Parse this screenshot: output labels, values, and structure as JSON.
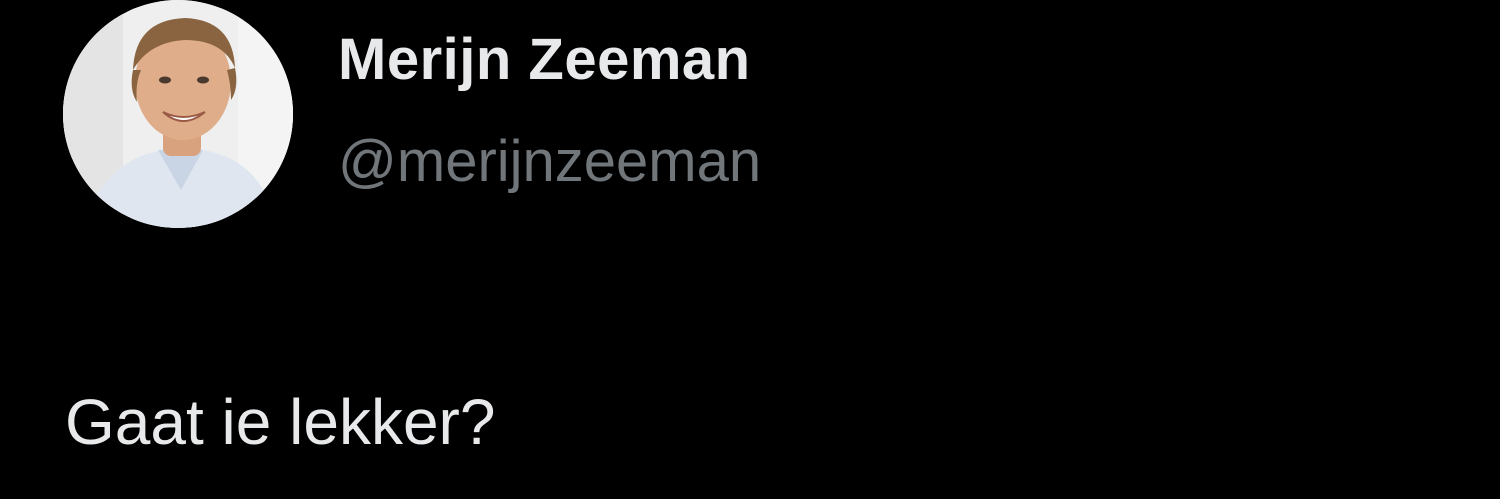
{
  "tweet": {
    "author": {
      "display_name": "Merijn Zeeman",
      "handle": "@merijnzeeman",
      "avatar_icon": "profile-photo"
    },
    "text": "Gaat ie lekker?"
  },
  "colors": {
    "background": "#000000",
    "primary_text": "#e7e9ea",
    "secondary_text": "#71767b"
  }
}
